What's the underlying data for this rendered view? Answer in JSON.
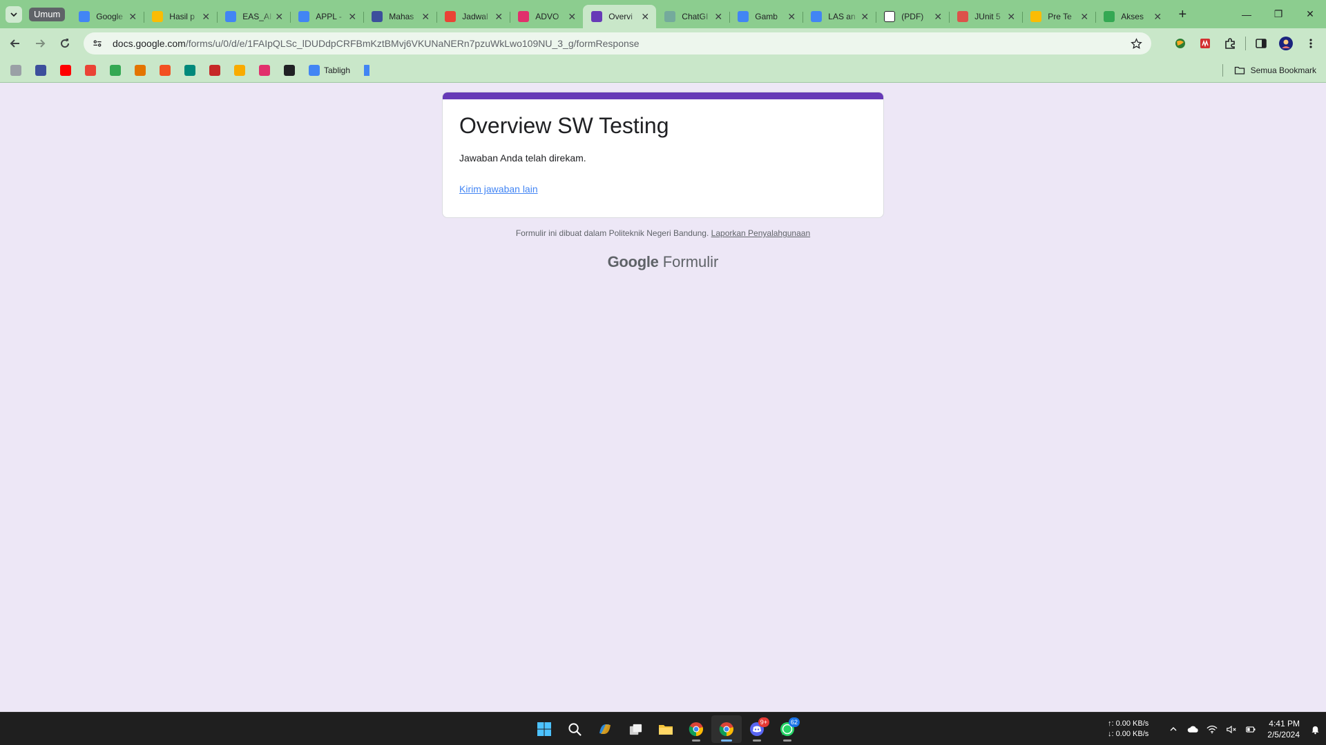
{
  "browser": {
    "tab_group": "Umum",
    "tabs": [
      {
        "title": "Google",
        "icon": "google-icon",
        "color": "#4285f4"
      },
      {
        "title": "Hasil p",
        "icon": "google-drive-icon",
        "color": "#fbbc04"
      },
      {
        "title": "EAS_AI",
        "icon": "google-docs-icon",
        "color": "#4285f4"
      },
      {
        "title": "APPL -",
        "icon": "google-docs-icon",
        "color": "#4285f4"
      },
      {
        "title": "Mahas",
        "icon": "moodle-icon",
        "color": "#3c4f9c"
      },
      {
        "title": "Jadwal",
        "icon": "gmail-icon",
        "color": "#ea4335"
      },
      {
        "title": "ADVO",
        "icon": "instagram-icon",
        "color": "#e1306c"
      },
      {
        "title": "Overvi",
        "icon": "google-forms-icon",
        "color": "#673ab7",
        "active": true
      },
      {
        "title": "ChatGI",
        "icon": "chatgpt-icon",
        "color": "#74aa9c"
      },
      {
        "title": "Gamb",
        "icon": "google-docs-icon",
        "color": "#4285f4"
      },
      {
        "title": "LAS an",
        "icon": "google-icon",
        "color": "#4285f4"
      },
      {
        "title": "(PDF)",
        "icon": "researchgate-icon",
        "color": "#ffffff"
      },
      {
        "title": "JUnit 5",
        "icon": "junit-icon",
        "color": "#dc524a"
      },
      {
        "title": "Pre Te",
        "icon": "google-drive-icon",
        "color": "#fbbc04"
      },
      {
        "title": "Akses",
        "icon": "google-drive-icon",
        "color": "#34a853"
      }
    ],
    "url_host": "docs.google.com",
    "url_path": "/forms/u/0/d/e/1FAIpQLSc_lDUDdpCRFBmKztBMvj6VKUNaNERn7pzuWkLwo109NU_3_g/formResponse",
    "bookmarks": [
      {
        "label": "",
        "icon": "chatgpt-icon",
        "color": "#9aa0a6"
      },
      {
        "label": "",
        "icon": "moodle-icon",
        "color": "#3c4f9c"
      },
      {
        "label": "",
        "icon": "youtube-icon",
        "color": "#ff0000"
      },
      {
        "label": "",
        "icon": "gmail-icon",
        "color": "#ea4335"
      },
      {
        "label": "",
        "icon": "google-drive-icon",
        "color": "#34a853"
      },
      {
        "label": "",
        "icon": "book-icon",
        "color": "#e37400"
      },
      {
        "label": "",
        "icon": "microsoft-icon",
        "color": "#f25022"
      },
      {
        "label": "",
        "icon": "google-meet-icon",
        "color": "#00897b"
      },
      {
        "label": "",
        "icon": "discord-shield-icon",
        "color": "#c62828"
      },
      {
        "label": "",
        "icon": "google-classroom-icon",
        "color": "#f9ab00"
      },
      {
        "label": "",
        "icon": "instagram-icon",
        "color": "#e1306c"
      },
      {
        "label": "",
        "icon": "globe-icon",
        "color": "#202124"
      },
      {
        "label": "Tabligh",
        "icon": "google-icon",
        "color": "#4285f4"
      },
      {
        "label": "",
        "icon": "bookmark-icon",
        "color": "#4285f4"
      }
    ],
    "all_bookmarks": "Semua Bookmark"
  },
  "form": {
    "title": "Overview SW Testing",
    "message": "Jawaban Anda telah direkam.",
    "link": "Kirim jawaban lain",
    "accent": "#673ab7",
    "footer_text": "Formulir ini dibuat dalam Politeknik Negeri Bandung.",
    "footer_link": "Laporkan Penyalahgunaan",
    "brand_google": "Google",
    "brand_product": "Formulir"
  },
  "taskbar": {
    "apps": [
      {
        "name": "start",
        "icon": "windows-icon"
      },
      {
        "name": "search",
        "icon": "search-icon"
      },
      {
        "name": "copilot",
        "icon": "copilot-icon"
      },
      {
        "name": "task-view",
        "icon": "task-view-icon"
      },
      {
        "name": "file-explorer",
        "icon": "folder-icon"
      },
      {
        "name": "chrome",
        "icon": "chrome-icon"
      },
      {
        "name": "chrome-active",
        "icon": "chrome-icon",
        "active": true
      },
      {
        "name": "discord",
        "icon": "discord-icon",
        "badge": "9+"
      },
      {
        "name": "whatsapp",
        "icon": "whatsapp-icon",
        "badge": "62"
      }
    ],
    "net_up": "↑: 0.00 KB/s",
    "net_down": "↓: 0.00 KB/s",
    "time": "4:41 PM",
    "date": "2/5/2024"
  }
}
